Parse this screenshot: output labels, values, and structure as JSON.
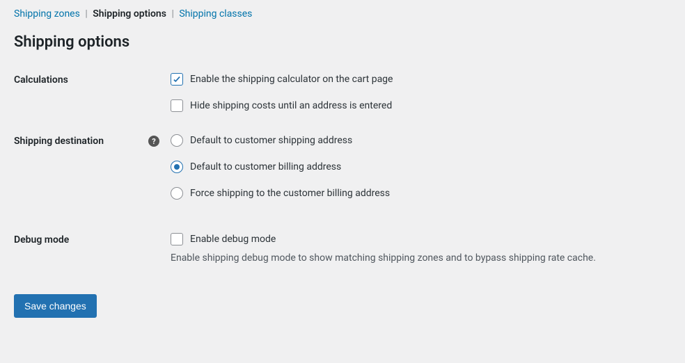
{
  "tabs": {
    "shipping_zones": "Shipping zones",
    "shipping_options": "Shipping options",
    "shipping_classes": "Shipping classes"
  },
  "page_title": "Shipping options",
  "sections": {
    "calculations": {
      "label": "Calculations",
      "enable_calc": "Enable the shipping calculator on the cart page",
      "hide_costs": "Hide shipping costs until an address is entered"
    },
    "destination": {
      "label": "Shipping destination",
      "opt_shipping": "Default to customer shipping address",
      "opt_billing": "Default to customer billing address",
      "opt_force": "Force shipping to the customer billing address"
    },
    "debug": {
      "label": "Debug mode",
      "enable_debug": "Enable debug mode",
      "description": "Enable shipping debug mode to show matching shipping zones and to bypass shipping rate cache."
    }
  },
  "save_label": "Save changes",
  "help_tooltip": "?"
}
